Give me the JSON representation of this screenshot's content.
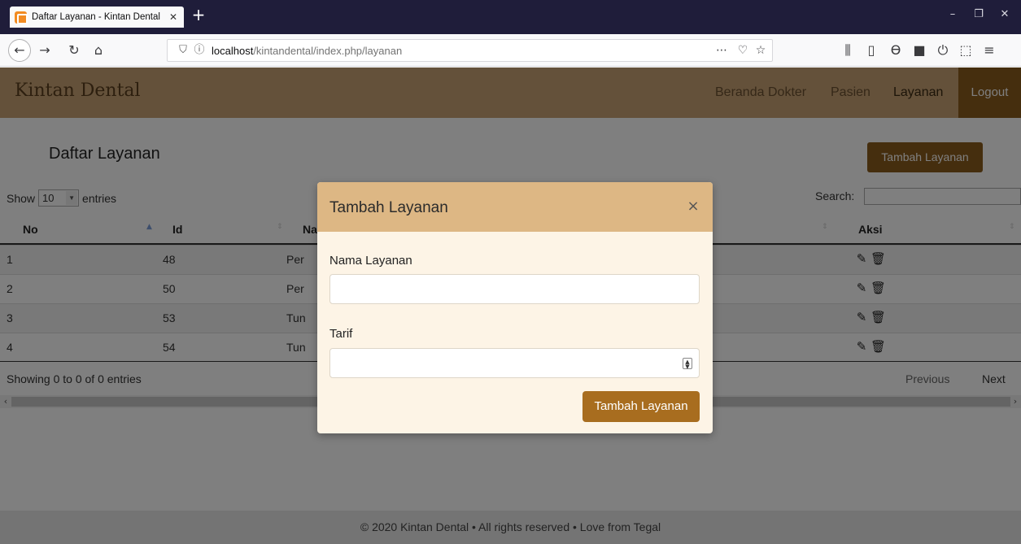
{
  "browser": {
    "tab_title": "Daftar Layanan - Kintan Dental",
    "tab_close": "✕",
    "new_tab": "+",
    "url_host": "localhost",
    "url_path": "/kintandental/index.php/layanan",
    "window_controls": [
      "–",
      "❐",
      "✕"
    ]
  },
  "site": {
    "brand": "Kintan Dental",
    "menu": [
      "Beranda",
      "Dokter",
      "Pasien",
      "Layanan"
    ],
    "logout": "Logout"
  },
  "page": {
    "title": "Daftar Layanan",
    "add_button": "Tambah Layanan",
    "show_label": "Show",
    "entries_label": "entries",
    "page_length": "10",
    "search_label": "Search:",
    "columns": [
      "No",
      "Id",
      "Na",
      "Aksi"
    ],
    "rows": [
      {
        "no": "1",
        "id": "48",
        "name": "Per",
        "extra": ""
      },
      {
        "no": "2",
        "id": "50",
        "name": "Per",
        "extra": ")"
      },
      {
        "no": "3",
        "id": "53",
        "name": "Tun",
        "extra": ")"
      },
      {
        "no": "4",
        "id": "54",
        "name": "Tun",
        "extra": ")"
      }
    ],
    "info": "Showing 0 to 0 of 0 entries",
    "previous": "Previous",
    "next": "Next"
  },
  "footer": {
    "text": "© 2020 Kintan Dental • All rights reserved • Love from Tegal"
  },
  "modal": {
    "title": "Tambah Layanan",
    "close": "×",
    "name_label": "Nama Layanan",
    "name_value": "",
    "tarif_label": "Tarif",
    "tarif_value": "",
    "submit": "Tambah Layanan"
  }
}
